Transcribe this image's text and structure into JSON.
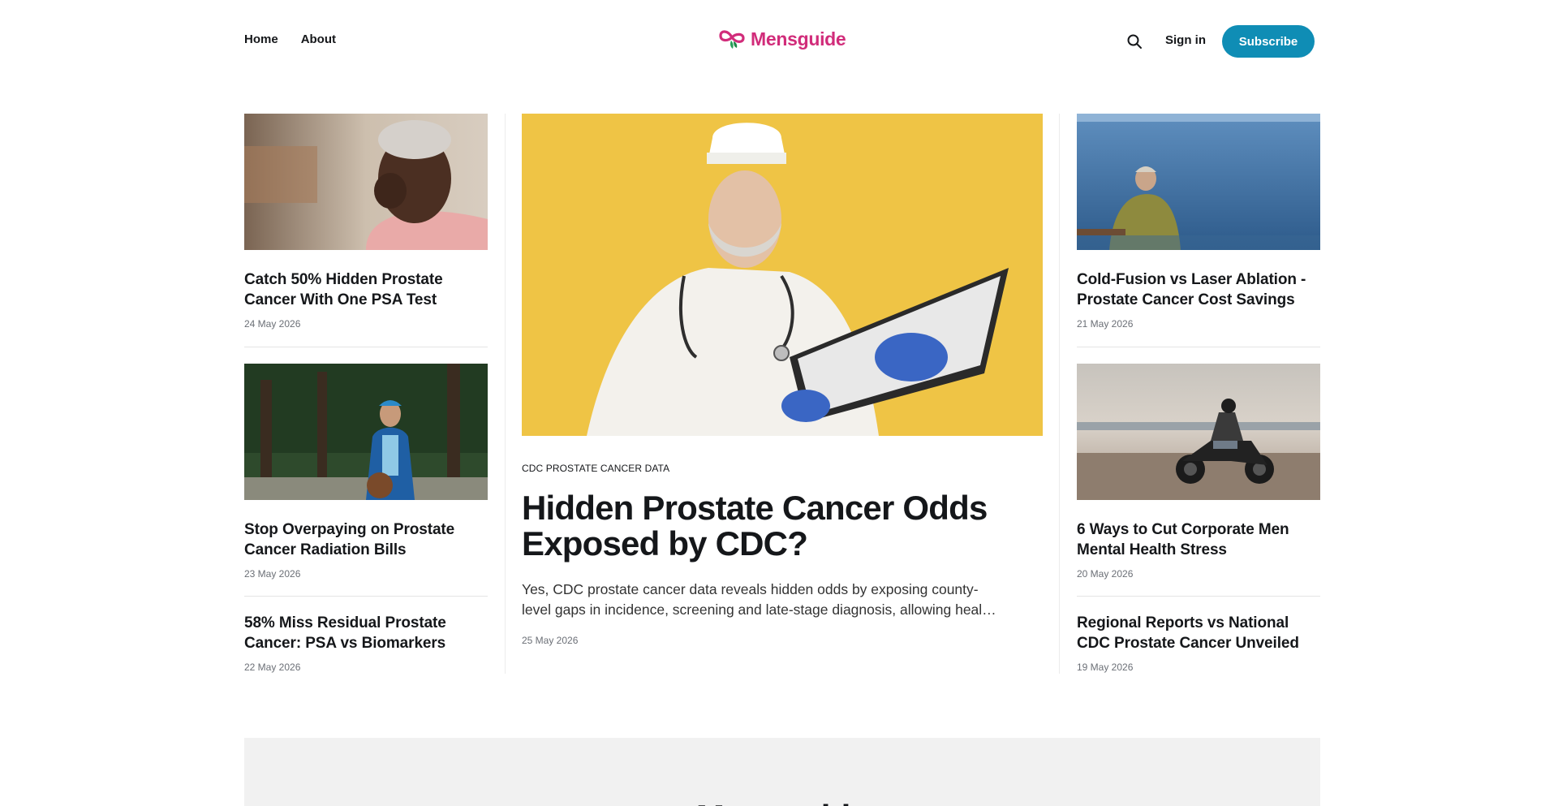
{
  "nav": {
    "home": "Home",
    "about": "About"
  },
  "brand": {
    "name": "Mensguide",
    "color": "#d12c7a",
    "icon": "infinity-leaf-icon"
  },
  "header": {
    "sign_in": "Sign in",
    "subscribe": "Subscribe",
    "search_icon": "search-icon",
    "accent": "#0f8db5"
  },
  "left_column": [
    {
      "title": "Catch 50% Hidden Prostate Cancer With One PSA Test",
      "date": "24 May 2026"
    },
    {
      "title": "Stop Overpaying on Prostate Cancer Radiation Bills",
      "date": "23 May 2026"
    },
    {
      "title": "58% Miss Residual Prostate Cancer: PSA vs Biomarkers",
      "date": "22 May 2026"
    }
  ],
  "featured": {
    "tag": "CDC PROSTATE CANCER DATA",
    "title": "Hidden Prostate Cancer Odds Exposed by CDC?",
    "excerpt": "Yes, CDC prostate cancer data reveals hidden odds by exposing county-level gaps in incidence, screening and late-stage diagnosis, allowing heal…",
    "date": "25 May 2026"
  },
  "right_column": [
    {
      "title": "Cold-Fusion vs Laser Ablation - Prostate Cancer Cost Savings",
      "date": "21 May 2026"
    },
    {
      "title": "6 Ways to Cut Corporate Men Mental Health Stress",
      "date": "20 May 2026"
    },
    {
      "title": "Regional Reports vs National CDC Prostate Cancer Unveiled",
      "date": "19 May 2026"
    }
  ],
  "newsletter": {
    "title": "Mensguide"
  }
}
